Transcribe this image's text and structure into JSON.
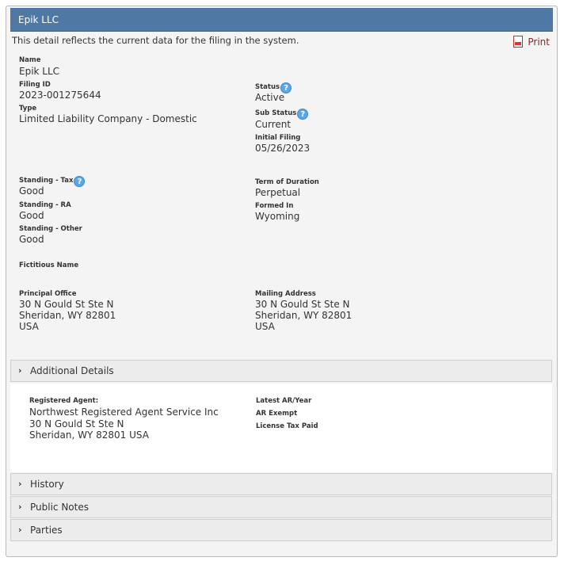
{
  "header": {
    "title": "Epik LLC"
  },
  "intro": "This detail reflects the current data for the filing in the system.",
  "print_label": "Print",
  "fields": {
    "name": {
      "label": "Name",
      "value": "Epik LLC"
    },
    "filing_id": {
      "label": "Filing ID",
      "value": "2023-001275644"
    },
    "type": {
      "label": "Type",
      "value": "Limited Liability Company - Domestic"
    },
    "status": {
      "label": "Status",
      "value": "Active"
    },
    "sub_status": {
      "label": "Sub Status",
      "value": "Current"
    },
    "initial_filing": {
      "label": "Initial Filing",
      "value": "05/26/2023"
    },
    "standing_tax": {
      "label": "Standing - Tax",
      "value": "Good"
    },
    "standing_ra": {
      "label": "Standing - RA",
      "value": "Good"
    },
    "standing_other": {
      "label": "Standing - Other",
      "value": "Good"
    },
    "term_of_duration": {
      "label": "Term of Duration",
      "value": "Perpetual"
    },
    "formed_in": {
      "label": "Formed In",
      "value": "Wyoming"
    },
    "fictitious_name": {
      "label": "Fictitious Name"
    },
    "principal_office": {
      "label": "Principal Office",
      "lines": [
        "30 N Gould St Ste N",
        "Sheridan, WY 82801",
        "USA"
      ]
    },
    "mailing_address": {
      "label": "Mailing Address",
      "lines": [
        "30 N Gould St Ste N",
        "Sheridan, WY 82801",
        "USA"
      ]
    }
  },
  "help_glyph": "?",
  "accordion": {
    "additional_details": "Additional Details",
    "history": "History",
    "public_notes": "Public Notes",
    "parties": "Parties",
    "chevron": "›"
  },
  "additional": {
    "registered_agent_label": "Registered Agent:",
    "registered_agent_lines": [
      "Northwest Registered Agent Service Inc",
      "30 N Gould St Ste N",
      "Sheridan, WY 82801 USA"
    ],
    "latest_ar_label": "Latest AR/Year",
    "ar_exempt_label": "AR Exempt",
    "license_tax_label": "License Tax Paid"
  },
  "colors": {
    "title_bar": "#4f78a4",
    "print_link": "#7a2b2b",
    "help_icon": "#5aa7e8"
  }
}
